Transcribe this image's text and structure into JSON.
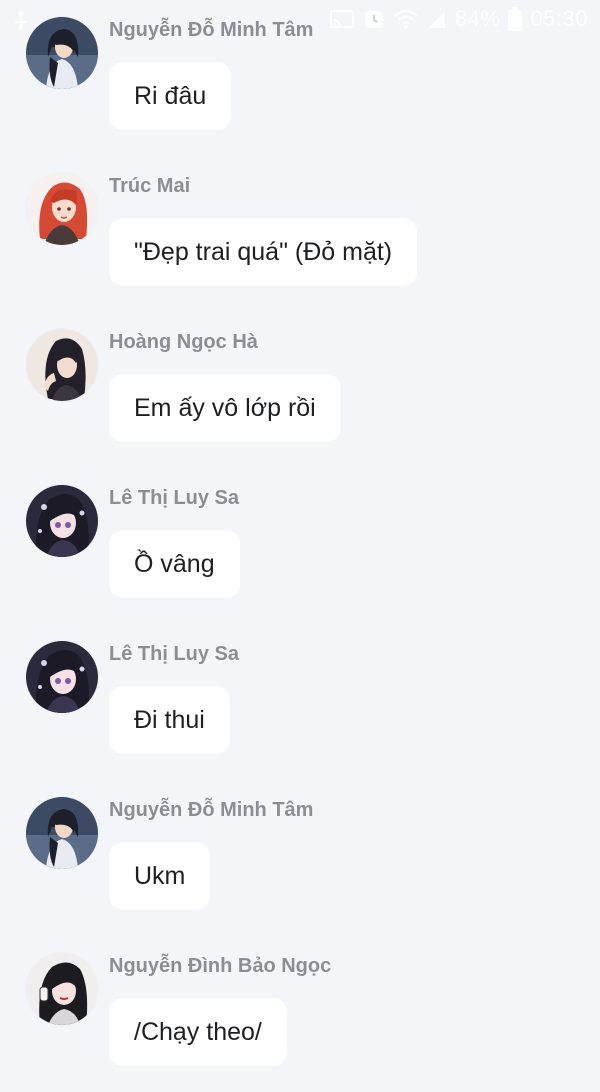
{
  "status_bar": {
    "battery_percent": "84%",
    "time": "05:30",
    "icons": [
      "notification-icon",
      "cast-icon",
      "alarm-icon",
      "wifi-icon",
      "signal-icon",
      "battery-icon"
    ]
  },
  "messages": [
    {
      "sender": "Nguyễn Đỗ Minh Tâm",
      "text": "Ri đâu",
      "avatar": "avatar-dark-hair-woman"
    },
    {
      "sender": "Trúc Mai",
      "text": "\"Đẹp trai quá\" (Đỏ mặt)",
      "avatar": "avatar-red-hair-woman"
    },
    {
      "sender": "Hoàng Ngọc Hà",
      "text": "Em ấy vô lớp rồi",
      "avatar": "avatar-black-hair-woman"
    },
    {
      "sender": "Lê Thị Luy Sa",
      "text": "Ồ vâng",
      "avatar": "avatar-anime-girl"
    },
    {
      "sender": "Lê Thị Luy Sa",
      "text": "Đi thui",
      "avatar": "avatar-anime-girl"
    },
    {
      "sender": "Nguyễn Đỗ Minh Tâm",
      "text": "Ukm",
      "avatar": "avatar-dark-hair-woman"
    },
    {
      "sender": "Nguyễn Đình Bảo Ngọc",
      "text": "/Chạy theo/",
      "avatar": "avatar-headphones-girl"
    }
  ],
  "colors": {
    "background": "#f4f5f8",
    "bubble": "#ffffff",
    "sender_name": "#8b8e94",
    "message_text": "#1e1f22"
  }
}
